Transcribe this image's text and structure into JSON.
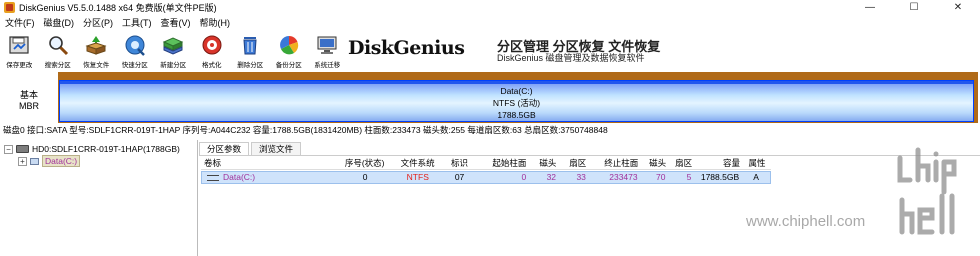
{
  "titlebar": {
    "title": "DiskGenius V5.5.0.1488 x64 免费版(单文件PE版)",
    "minimize": "—",
    "maximize": "☐",
    "close": "✕"
  },
  "menu": [
    "文件(F)",
    "磁盘(D)",
    "分区(P)",
    "工具(T)",
    "查看(V)",
    "帮助(H)"
  ],
  "toolbar": [
    {
      "label": "保存更改",
      "icon": "save-icon"
    },
    {
      "label": "搜索分区",
      "icon": "search-partition-icon"
    },
    {
      "label": "恢复文件",
      "icon": "recover-files-icon"
    },
    {
      "label": "快速分区",
      "icon": "quick-partition-icon"
    },
    {
      "label": "新建分区",
      "icon": "new-partition-icon"
    },
    {
      "label": "格式化",
      "icon": "format-icon"
    },
    {
      "label": "删除分区",
      "icon": "delete-partition-icon"
    },
    {
      "label": "备份分区",
      "icon": "backup-partition-icon"
    },
    {
      "label": "系统迁移",
      "icon": "system-migration-icon"
    }
  ],
  "banner": {
    "logo": "DiskGenius",
    "headline": "分区管理 分区恢复 文件恢复",
    "subline": "DiskGenius 磁盘管理及数据恢复软件"
  },
  "diskmap": {
    "disk_label_line1": "基本",
    "disk_label_line2": "MBR",
    "partition_name": "Data(C:)",
    "partition_fs": "NTFS (活动)",
    "partition_size": "1788.5GB"
  },
  "info_line": "磁盘0 接口:SATA  型号:SDLF1CRR-019T-1HAP  序列号:A044C232  容量:1788.5GB(1831420MB)  柱面数:233473  磁头数:255  每道扇区数:63  总扇区数:3750748848",
  "tree": {
    "root_label": "HD0:SDLF1CRR-019T-1HAP(1788GB)",
    "child_label": "Data(C:)",
    "toggle_root": "−",
    "toggle_child": "+"
  },
  "tabs": [
    "分区参数",
    "浏览文件"
  ],
  "table": {
    "headers": [
      "卷标",
      "序号(状态)",
      "文件系统",
      "标识",
      "起始柱面",
      "磁头",
      "扇区",
      "终止柱面",
      "磁头",
      "扇区",
      "容量",
      "属性"
    ],
    "rows": [
      {
        "name": "Data(C:)",
        "seq": "0",
        "fs": "NTFS",
        "id": "07",
        "start_cyl": "0",
        "start_head": "32",
        "start_sec": "33",
        "end_cyl": "233473",
        "end_head": "70",
        "end_sec": "5",
        "capacity": "1788.5GB",
        "attr": "A"
      }
    ]
  },
  "watermark": {
    "url": "www.chiphell.com"
  },
  "colors": {
    "partition_border": "#0040ff",
    "disk_frame": "#b06a18",
    "selected_row": "#cfe3fb",
    "red_text": "#e3221b",
    "purple_text": "#a0309b"
  }
}
